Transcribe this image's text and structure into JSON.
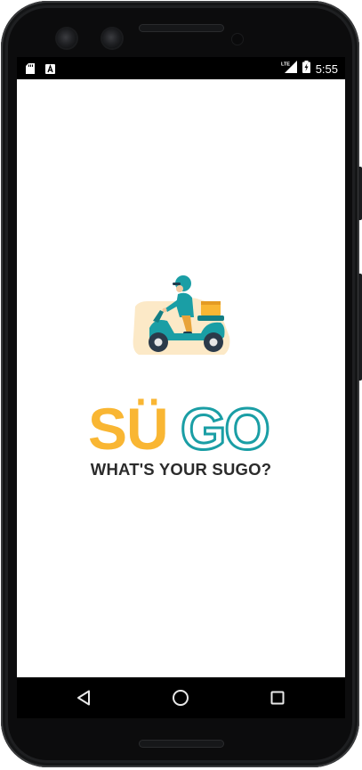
{
  "status_bar": {
    "time": "5:55",
    "network_label": "LTE",
    "left_icons": [
      "sd-card-icon",
      "a-notification-icon"
    ],
    "right_icons": [
      "lte-signal-icon",
      "battery-charging-icon"
    ]
  },
  "app": {
    "logo": {
      "part1": "SÜ",
      "part2": "GO",
      "part1_color": "#f9b633",
      "part2_color": "#1a9ea5"
    },
    "tagline": "WHAT'S YOUR SUGO?",
    "illustration_icon": "delivery-scooter-rider-icon"
  },
  "nav_bar": {
    "back_icon": "back-triangle-icon",
    "home_icon": "home-circle-icon",
    "recents_icon": "recents-square-icon"
  },
  "colors": {
    "accent_yellow": "#f9b633",
    "accent_teal": "#1a9ea5",
    "text_dark": "#2b2b2b"
  }
}
